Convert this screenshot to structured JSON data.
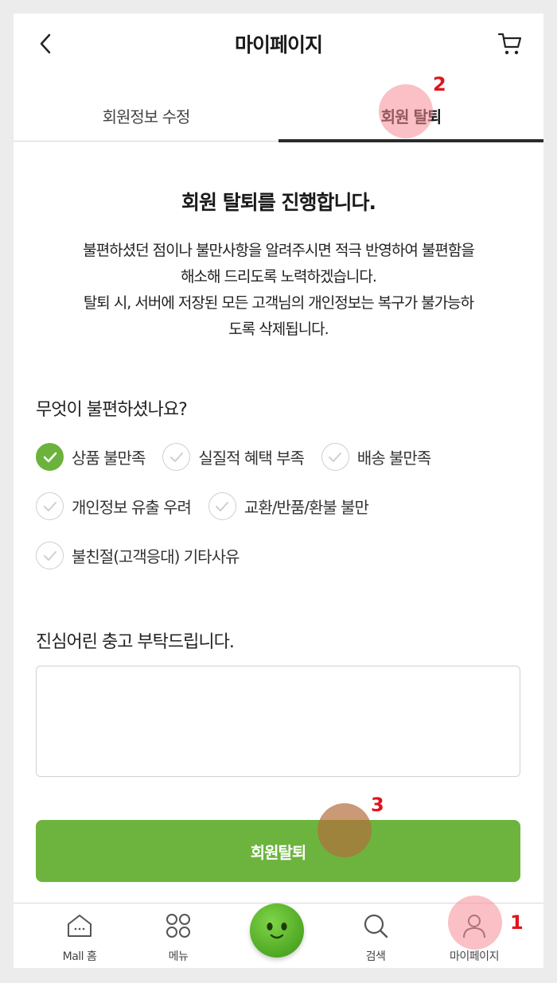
{
  "header": {
    "title": "마이페이지"
  },
  "tabs": [
    {
      "label": "회원정보 수정",
      "active": false
    },
    {
      "label": "회원 탈퇴",
      "active": true
    }
  ],
  "intro": {
    "title": "회원 탈퇴를 진행합니다.",
    "lines": [
      "불편하셨던 점이나 불만사항을 알려주시면 적극 반영하여 불편함을",
      "해소해 드리도록 노력하겠습니다.",
      "탈퇴 시, 서버에 저장된 모든 고객님의 개인정보는 복구가 불가능하",
      "도록 삭제됩니다."
    ]
  },
  "reasons": {
    "question": "무엇이 불편하셨나요?",
    "items": [
      {
        "label": "상품 불만족",
        "checked": true
      },
      {
        "label": "실질적 혜택 부족",
        "checked": false
      },
      {
        "label": "배송 불만족",
        "checked": false
      },
      {
        "label": "개인정보 유출 우려",
        "checked": false
      },
      {
        "label": "교환/반품/환불 불만",
        "checked": false
      },
      {
        "label": "불친절(고객응대) 기타사유",
        "checked": false
      }
    ]
  },
  "feedback": {
    "label": "진심어린 충고 부탁드립니다.",
    "value": "",
    "placeholder": ""
  },
  "withdraw_button": "회원탈퇴",
  "bottom_nav": [
    {
      "label": "Mall 홈",
      "icon": "home-icon"
    },
    {
      "label": "메뉴",
      "icon": "menu-grid-icon"
    },
    {
      "label": "",
      "icon": "mascot-face-icon"
    },
    {
      "label": "검색",
      "icon": "search-icon"
    },
    {
      "label": "마이페이지",
      "icon": "user-icon"
    }
  ],
  "annotations": [
    {
      "number": "1",
      "target": "nav-mypage"
    },
    {
      "number": "2",
      "target": "tab-withdraw"
    },
    {
      "number": "3",
      "target": "withdraw-button"
    }
  ],
  "colors": {
    "accent": "#6cb43e",
    "marker": "#f68c96",
    "marker_number": "#e0141e"
  }
}
